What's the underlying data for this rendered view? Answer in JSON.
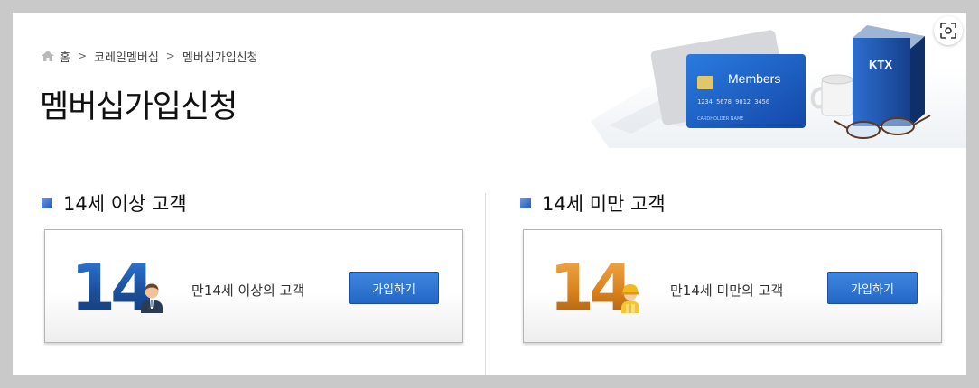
{
  "breadcrumb": {
    "home": "홈",
    "items": [
      "코레일멤버십",
      "멤버십가입신청"
    ],
    "separator": ">"
  },
  "page_title": "멤버십가입신청",
  "hero": {
    "card_label": "Members",
    "card_number": "1234  5678  9012  3456",
    "card_holder": "CARDHOLDER NAME",
    "book_label": "KTX"
  },
  "sections": {
    "adult": {
      "heading": "14세 이상 고객",
      "badge_number": "14",
      "description": "만14세 이상의 고객",
      "button": "가입하기",
      "accent": "#1b4f9c"
    },
    "child": {
      "heading": "14세 미만 고객",
      "badge_number": "14",
      "description": "만14세 미만의 고객",
      "button": "가입하기",
      "accent": "#d9821d"
    }
  },
  "icons": {
    "home": "home-icon",
    "scan": "scan-icon",
    "adult_person": "businessman-icon",
    "child_person": "child-icon"
  }
}
